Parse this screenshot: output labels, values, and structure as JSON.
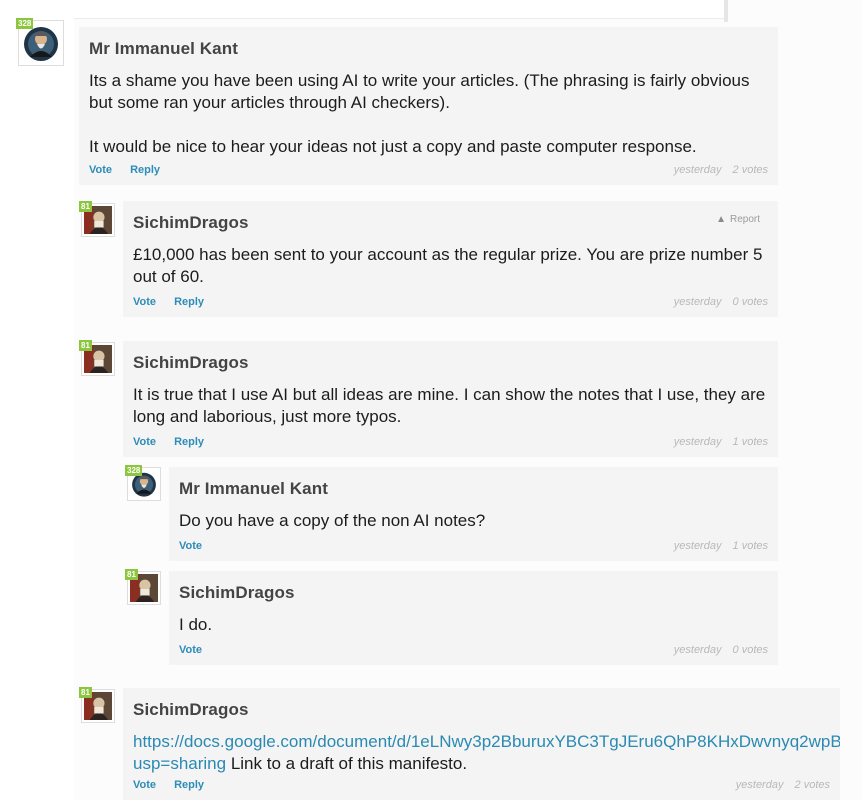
{
  "comments": [
    {
      "author": "Mr Immanuel Kant",
      "badge": "328",
      "avatar_icon": "wizard-avatar",
      "paragraphs": [
        "Its a shame you have been using AI to write your articles. (The phrasing is fairly obvious but some ran your articles through AI checkers).",
        "It would be nice to hear your ideas not just a copy and paste computer response."
      ],
      "vote_label": "Vote",
      "reply_label": "Reply",
      "time": "yesterday",
      "votes": "2 votes"
    },
    {
      "author": "SichimDragos",
      "badge": "81",
      "avatar_icon": "portrait-avatar",
      "report_label": "Report",
      "text": "£10,000 has been sent to your account as the regular prize. You are prize number 5 out of 60.",
      "vote_label": "Vote",
      "reply_label": "Reply",
      "time": "yesterday",
      "votes": "0 votes"
    },
    {
      "author": "SichimDragos",
      "badge": "81",
      "avatar_icon": "portrait-avatar",
      "text": "It is true that I use AI but all ideas are mine. I can show the notes that I use, they are long and laborious, just more typos.",
      "vote_label": "Vote",
      "reply_label": "Reply",
      "time": "yesterday",
      "votes": "1 votes"
    },
    {
      "author": "Mr Immanuel Kant",
      "badge": "328",
      "avatar_icon": "wizard-avatar",
      "text": "Do you have a copy of the non AI notes?",
      "vote_label": "Vote",
      "time": "yesterday",
      "votes": "1 votes"
    },
    {
      "author": "SichimDragos",
      "badge": "81",
      "avatar_icon": "portrait-avatar",
      "text": "I do.",
      "vote_label": "Vote",
      "time": "yesterday",
      "votes": "0 votes"
    },
    {
      "author": "SichimDragos",
      "badge": "81",
      "avatar_icon": "portrait-avatar",
      "link_line1": "https://docs.google.com/document/d/1eLNwy3p2BburuxYBC3TgJEru6QhP8KHxDwvnyq2wpB",
      "link_line2": "usp=sharing",
      "link_suffix": " Link to a draft of this manifesto.",
      "vote_label": "Vote",
      "reply_label": "Reply",
      "time": "yesterday",
      "votes": "2 votes"
    }
  ],
  "colors": {
    "badge": "#8cc63f",
    "action_link": "#2e8cb8",
    "meta": "#b8b8b8",
    "card_bg": "#f4f4f4"
  }
}
